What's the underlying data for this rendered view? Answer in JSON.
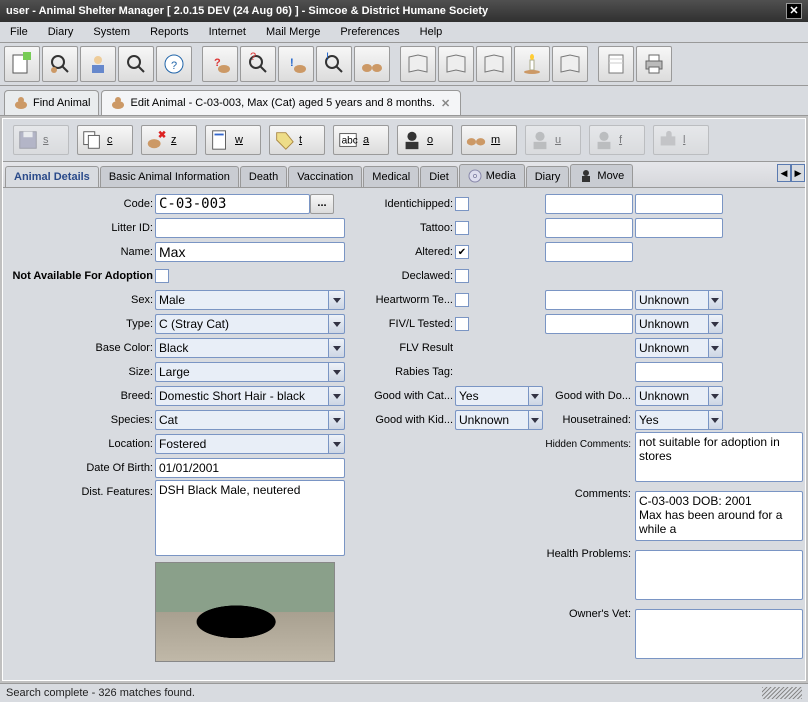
{
  "window": {
    "title": "user - Animal Shelter Manager [ 2.0.15 DEV (24 Aug 06) ] - Simcoe & District Humane Society"
  },
  "menu": [
    "File",
    "Diary",
    "System",
    "Reports",
    "Internet",
    "Mail Merge",
    "Preferences",
    "Help"
  ],
  "main_tabs": {
    "find": "Find Animal",
    "edit": "Edit Animal - C-03-003, Max (Cat) aged 5 years and 8 months."
  },
  "actions": {
    "s": "s",
    "c": "c",
    "z": "z",
    "w": "w",
    "t": "t",
    "a": "a",
    "o": "o",
    "m": "m",
    "u": "u",
    "f": "f",
    "l": "l"
  },
  "subtabs": [
    "Animal Details",
    "Basic Animal Information",
    "Death",
    "Vaccination",
    "Medical",
    "Diet",
    "Media",
    "Diary",
    "Move"
  ],
  "labels": {
    "code": "Code:",
    "litter": "Litter ID:",
    "name": "Name:",
    "notavail": "Not Available For Adoption",
    "sex": "Sex:",
    "type": "Type:",
    "basecolor": "Base Color:",
    "size": "Size:",
    "breed": "Breed:",
    "species": "Species:",
    "location": "Location:",
    "dob": "Date Of Birth:",
    "features": "Dist. Features:",
    "ident": "Identichipped:",
    "tattoo": "Tattoo:",
    "altered": "Altered:",
    "declawed": "Declawed:",
    "heartworm": "Heartworm Te...",
    "fivl": "FIV/L Tested:",
    "flv": "FLV Result",
    "rabies": "Rabies Tag:",
    "goodcat": "Good with Cat...",
    "goodkid": "Good with Kid...",
    "gooddog": "Good with Do...",
    "house": "Housetrained:",
    "hidden": "Hidden Comments:",
    "comments": "Comments:",
    "health": "Health Problems:",
    "vet": "Owner's Vet:"
  },
  "fields": {
    "code": "C-03-003",
    "litter": "",
    "name": "Max",
    "sex": "Male",
    "type": "C (Stray Cat)",
    "basecolor": "Black",
    "size": "Large",
    "breed": "Domestic Short Hair - black",
    "species": "Cat",
    "location": "Fostered",
    "dob": "01/01/2001",
    "features": "DSH Black Male, neutered",
    "altered": true,
    "goodcat": "Yes",
    "goodkid": "Unknown",
    "gooddog": "Unknown",
    "house": "Yes",
    "heartworm_res": "Unknown",
    "fivl_res": "Unknown",
    "flv_res": "Unknown",
    "rabies": "",
    "hidden": "not suitable for adoption in stores",
    "comments": "C-03-003 DOB: 2001\nMax has been around for a while a",
    "health": "",
    "vet": ""
  },
  "status": "Search complete - 326 matches found."
}
